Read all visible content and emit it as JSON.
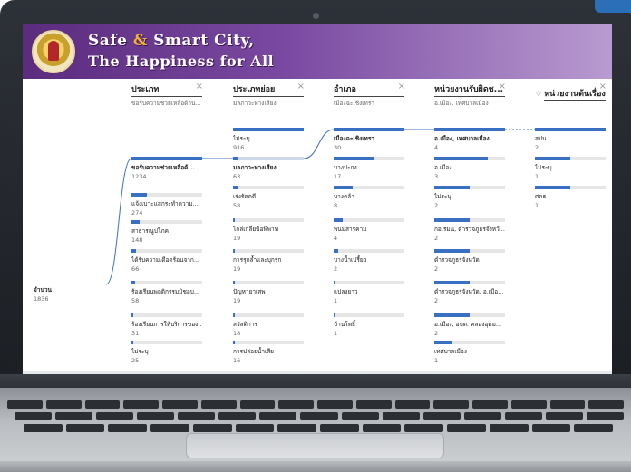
{
  "header": {
    "title_line1_a": "Safe ",
    "title_line1_amp": "&",
    "title_line1_b": " Smart City,",
    "title_line2": "The Happiness for All"
  },
  "root": {
    "label": "จำนวน",
    "value": "1836"
  },
  "columns": [
    {
      "title": "ประเภท",
      "subtitle": "ขอรับความช่วยเหลือด้าน...",
      "items": [
        {
          "label": "ขอรับความช่วยเหลือด้...",
          "value": "1234",
          "fill": 1.0,
          "selected": true
        },
        {
          "label": "แจ้งเบาะแสกระทำความ...",
          "value": "274",
          "fill": 0.22
        },
        {
          "label": "สาธารณูปโภค",
          "value": "148",
          "fill": 0.12
        },
        {
          "label": "ได้รับความเดือดร้อนจาก...",
          "value": "66",
          "fill": 0.06
        },
        {
          "label": "ร้องเรียนพฤติกรรมมิชอบ...",
          "value": "58",
          "fill": 0.05
        },
        {
          "label": "ร้องเรียนการให้บริการของ...",
          "value": "31",
          "fill": 0.03
        },
        {
          "label": "ไม่ระบุ",
          "value": "25",
          "fill": 0.02
        }
      ]
    },
    {
      "title": "ประเภทย่อย",
      "subtitle": "มลภาวะทางเสียง",
      "items": [
        {
          "label": "ไม่ระบุ",
          "value": "916",
          "fill": 1.0
        },
        {
          "label": "มลภาวะทางเสียง",
          "value": "63",
          "fill": 0.07,
          "selected": true
        },
        {
          "label": "เร่งรัดคดี",
          "value": "58",
          "fill": 0.06
        },
        {
          "label": "ไกล่เกลี่ยข้อพิพาท",
          "value": "19",
          "fill": 0.02
        },
        {
          "label": "การรุกล้ำและบุกรุก",
          "value": "19",
          "fill": 0.02
        },
        {
          "label": "ปัญหายาเสพ",
          "value": "19",
          "fill": 0.02
        },
        {
          "label": "สวัสดิการ",
          "value": "18",
          "fill": 0.02
        },
        {
          "label": "การปล่อยน้ำเสีย",
          "value": "16",
          "fill": 0.02
        }
      ]
    },
    {
      "title": "อำเภอ",
      "subtitle": "เมืองฉะเชิงเทรา",
      "items": [
        {
          "label": "เมืองฉะเชิงเทรา",
          "value": "30",
          "fill": 1.0,
          "selected": true
        },
        {
          "label": "บางปะกง",
          "value": "17",
          "fill": 0.57
        },
        {
          "label": "บางคล้า",
          "value": "8",
          "fill": 0.27
        },
        {
          "label": "พนมสารคาม",
          "value": "4",
          "fill": 0.13
        },
        {
          "label": "บางน้ำเปรี้ยว",
          "value": "2",
          "fill": 0.07
        },
        {
          "label": "แปลงยาว",
          "value": "1",
          "fill": 0.03
        },
        {
          "label": "บ้านโพธิ์",
          "value": "1",
          "fill": 0.03
        }
      ]
    },
    {
      "title": "หน่วยงานรับผิดช...",
      "subtitle": "อ.เมือง, เทศบาลเมือง",
      "items": [
        {
          "label": "อ.เมือง, เทศบาลเมือง",
          "value": "4",
          "fill": 1.0,
          "selected": true
        },
        {
          "label": "อ.เมือง",
          "value": "3",
          "fill": 0.75
        },
        {
          "label": "ไม่ระบุ",
          "value": "2",
          "fill": 0.5
        },
        {
          "label": "กอ.รมน, ตำรวจภูธรจังหวั...",
          "value": "2",
          "fill": 0.5
        },
        {
          "label": "ตำรวจภูธรจังหวัด",
          "value": "2",
          "fill": 0.5
        },
        {
          "label": "ตำรวจภูธรจังหวัด, อ.เมือ...",
          "value": "2",
          "fill": 0.5
        },
        {
          "label": "อ.เมือง, อบต. คลองอุดม...",
          "value": "2",
          "fill": 0.5
        },
        {
          "label": "เทศบาลเมือง",
          "value": "1",
          "fill": 0.25
        }
      ]
    },
    {
      "title": "หน่วยงานต้นเรื่อง",
      "subtitle": "",
      "items": [
        {
          "label": "สปน",
          "value": "2",
          "fill": 1.0
        },
        {
          "label": "ไม่ระบุ",
          "value": "1",
          "fill": 0.5
        },
        {
          "label": "ศดธ",
          "value": "1",
          "fill": 0.5
        }
      ]
    }
  ],
  "colors": {
    "bar": "#3a70c2",
    "track": "#e6e6e6",
    "header_start": "#5b2b7e",
    "header_end": "#b99ad0"
  },
  "icons": [
    "close-icon",
    "lightbulb-icon"
  ]
}
